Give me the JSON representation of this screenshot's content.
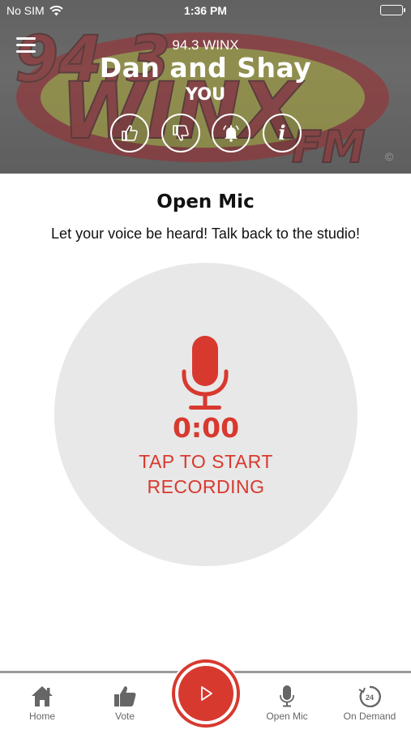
{
  "status_bar": {
    "carrier": "No SIM",
    "time": "1:36 PM",
    "wifi_icon": "wifi-icon",
    "battery_icon": "battery-icon"
  },
  "header": {
    "logo": {
      "number": "94.3",
      "letters": "WINX",
      "band": "FM",
      "copyright": "©"
    },
    "station_name": "94.3 WINX",
    "artist": "Dan and Shay",
    "title": "YOU",
    "actions": [
      {
        "icon": "thumbs-up-icon"
      },
      {
        "icon": "thumbs-down-icon"
      },
      {
        "icon": "bell-icon"
      },
      {
        "icon": "info-icon",
        "glyph": "i"
      }
    ]
  },
  "main": {
    "title": "Open Mic",
    "subtitle": "Let your voice be heard! Talk back to the studio!",
    "recorder": {
      "time": "0:00",
      "hint": "TAP TO START RECORDING"
    }
  },
  "tab_bar": {
    "tabs": [
      {
        "label": "Home",
        "icon": "home-icon"
      },
      {
        "label": "Vote",
        "icon": "thumbs-up-icon"
      },
      {
        "label": "Open Mic",
        "icon": "microphone-icon"
      },
      {
        "label": "On Demand",
        "icon": "on-demand-24-icon",
        "badge": "24"
      }
    ],
    "play_icon": "play-icon"
  },
  "colors": {
    "accent": "#d8392f",
    "record_circle": "#e8e8e8",
    "logo_red": "#c0262b",
    "logo_yellow": "#d6d23a",
    "tab_gray": "#666666"
  }
}
